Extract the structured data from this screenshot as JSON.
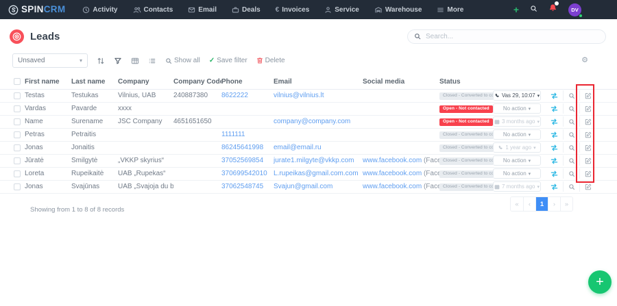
{
  "navbar": {
    "logo": {
      "spin": "SPIN",
      "crm": "CRM"
    },
    "items": [
      {
        "label": "Activity",
        "icon": "clock"
      },
      {
        "label": "Contacts",
        "icon": "users"
      },
      {
        "label": "Email",
        "icon": "envelope"
      },
      {
        "label": "Deals",
        "icon": "briefcase"
      },
      {
        "label": "Invoices",
        "icon": "euro"
      },
      {
        "label": "Service",
        "icon": "person"
      },
      {
        "label": "Warehouse",
        "icon": "warehouse"
      },
      {
        "label": "More",
        "icon": "menu"
      }
    ],
    "avatar_initials": "DV",
    "colors": {
      "bar": "#232c38",
      "crm_blue": "#4a90d9",
      "plus_green": "#2ab96f",
      "bell_red": "#f5484f",
      "avatar_purple": "#7c3fd0"
    }
  },
  "header": {
    "title": "Leads",
    "search_placeholder": "Search...",
    "icon_color": "#f8505a"
  },
  "toolbar": {
    "filter_select_value": "Unsaved",
    "show_all": "Show all",
    "save_filter": "Save filter",
    "delete": "Delete"
  },
  "table": {
    "columns": [
      "First name",
      "Last name",
      "Company",
      "Company Code",
      "Phone",
      "Email",
      "Social media",
      "Status"
    ],
    "status_labels": {
      "closed": "Closed - Converted to contact",
      "open": "Open - Not contacted"
    },
    "rows": [
      {
        "first": "Testas",
        "last": "Testukas",
        "company": "Vilnius, UAB",
        "code": "240887380",
        "phone": "8622222",
        "email": "vilnius@vilnius.lt",
        "social_link": "",
        "social_note": "",
        "status_type": "closed",
        "action_label": "Vas 29, 10:07",
        "action_icon": "phone",
        "action_tone": "dark"
      },
      {
        "first": "Vardas",
        "last": "Pavarde",
        "company": "xxxx",
        "code": "",
        "phone": "",
        "email": "",
        "social_link": "",
        "social_note": "",
        "status_type": "open",
        "action_label": "No action",
        "action_icon": "none",
        "action_tone": "normal"
      },
      {
        "first": "Name",
        "last": "Surename",
        "company": "JSC Company",
        "code": "4651651650",
        "phone": "",
        "email": "company@company.com",
        "social_link": "",
        "social_note": "",
        "status_type": "open",
        "action_label": "3 months ago",
        "action_icon": "calendar",
        "action_tone": "muted"
      },
      {
        "first": "Petras",
        "last": "Petraitis",
        "company": "",
        "code": "",
        "phone": "1111111",
        "email": "",
        "social_link": "",
        "social_note": "",
        "status_type": "closed",
        "action_label": "No action",
        "action_icon": "none",
        "action_tone": "normal"
      },
      {
        "first": "Jonas",
        "last": "Jonaitis",
        "company": "",
        "code": "",
        "phone": "86245641998",
        "email": "email@email.ru",
        "social_link": "",
        "social_note": "",
        "status_type": "closed",
        "action_label": "1 year ago",
        "action_icon": "phone",
        "action_tone": "muted"
      },
      {
        "first": "Jūratė",
        "last": "Smilgytė",
        "company": "„VKKP skyrius“",
        "code": "",
        "phone": "37052569854",
        "email": "jurate1.milgyte@vkkp.com",
        "social_link": "www.facebook.com",
        "social_note": "(Facebook)",
        "status_type": "closed",
        "action_label": "No action",
        "action_icon": "none",
        "action_tone": "normal"
      },
      {
        "first": "Loreta",
        "last": "Rupeikaitė",
        "company": "UAB „Rupekas“",
        "code": "",
        "phone": "370699542010",
        "email": "L.rupeikas@gmail.com.com",
        "social_link": "www.facebook.com",
        "social_note": "(Facebook)",
        "status_type": "closed",
        "action_label": "No action",
        "action_icon": "none",
        "action_tone": "normal"
      },
      {
        "first": "Jonas",
        "last": "Svajūnas",
        "company": "UAB „Svajoja du broliai“",
        "code": "",
        "phone": "37062548745",
        "email": "Svajun@gmail.com",
        "social_link": "www.facebook.com",
        "social_note": "(Facebook)",
        "status_type": "closed",
        "action_label": "7 months ago",
        "action_icon": "calendar",
        "action_tone": "muted"
      }
    ]
  },
  "annotation": {
    "shape": "rectangle",
    "color": "#ea2531",
    "highlights": "edit-lead-buttons-column"
  },
  "footer": {
    "showing_text": "Showing from 1 to 8 of 8 records",
    "pagination": {
      "first": "«",
      "prev": "‹",
      "page": "1",
      "next": "›",
      "last": "»",
      "active_page": "1"
    }
  },
  "fab": {
    "label": "+",
    "color": "#17c671"
  }
}
